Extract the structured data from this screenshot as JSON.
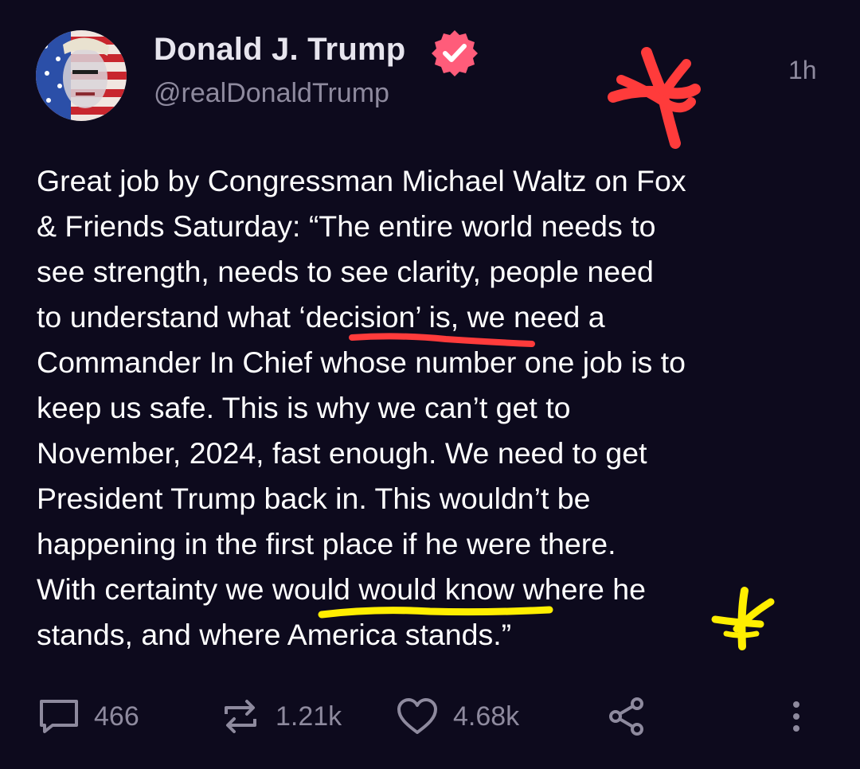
{
  "post": {
    "author": {
      "display_name": "Donald J. Trump",
      "handle": "@realDonaldTrump",
      "verified": true,
      "avatar_icon": "flag-portrait-avatar"
    },
    "timestamp": "1h",
    "text_lines": [
      "Great job by Congressman Michael Waltz on Fox",
      "& Friends Saturday: “The entire world needs to",
      "see strength, needs to see clarity, people need",
      "to understand what ‘decision’ is, we need a",
      "Commander In Chief whose number one job is to",
      "keep us safe. This is why we can’t get to",
      "November, 2024, fast enough. We need to get",
      "President Trump back in. This wouldn’t be",
      "happening in the first place if he were there.",
      "With certainty we would would know where he",
      "stands, and where America stands.”"
    ],
    "actions": {
      "reply_count": "466",
      "repost_count": "1.21k",
      "like_count": "4.68k",
      "reply_icon": "comment-icon",
      "repost_icon": "repost-icon",
      "like_icon": "heart-icon",
      "share_icon": "share-icon",
      "more_icon": "more-vertical-icon"
    }
  },
  "annotations": {
    "red_color": "#ff3b3b",
    "yellow_color": "#ffee00"
  },
  "colors": {
    "background": "#0d0a1d",
    "text": "#ffffff",
    "muted": "#8e8a9e",
    "verified_badge": "#ff5c7a"
  }
}
